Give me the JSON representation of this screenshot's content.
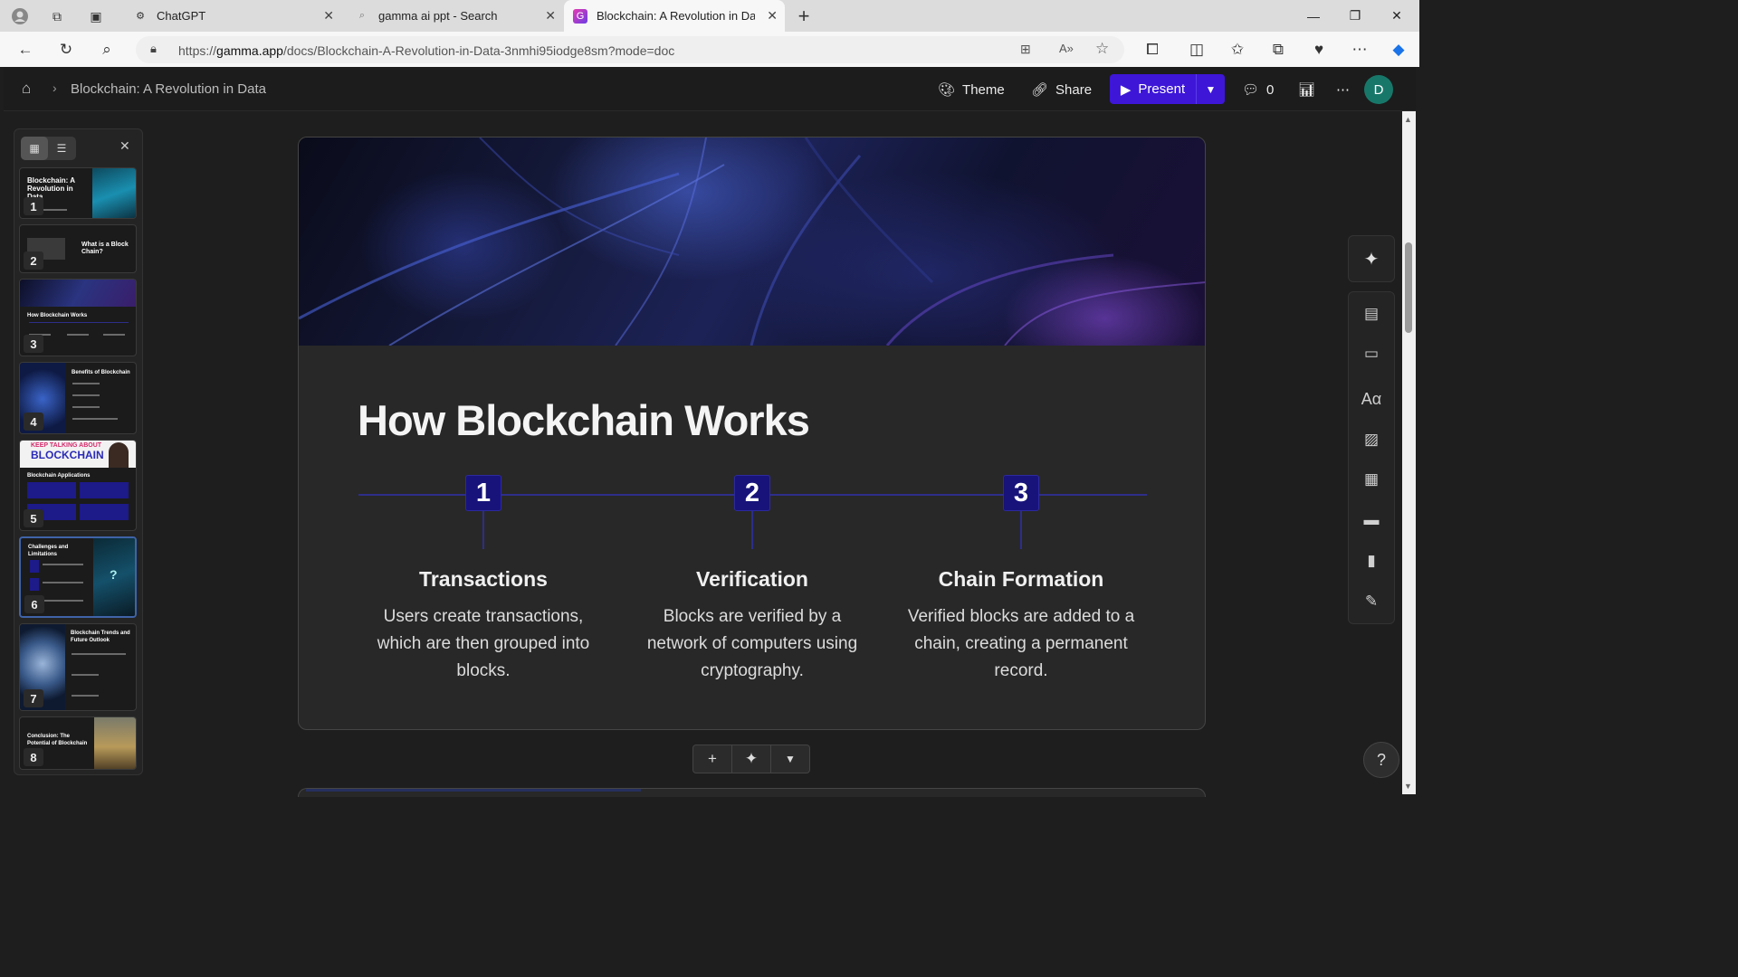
{
  "browser": {
    "tabs": [
      {
        "title": "ChatGPT",
        "icon": "chatgpt-icon"
      },
      {
        "title": "gamma ai ppt - Search",
        "icon": "search-icon"
      },
      {
        "title": "Blockchain: A Revolution in Data",
        "icon": "gamma-icon",
        "active": true
      }
    ],
    "url_prefix": "https://",
    "url_domain": "gamma.app",
    "url_path": "/docs/Blockchain-A-Revolution-in-Data-3nmhi95iodge8sm?mode=doc"
  },
  "app": {
    "breadcrumb": "Blockchain: A Revolution in Data",
    "theme_label": "Theme",
    "share_label": "Share",
    "present_label": "Present",
    "comments_count": "0",
    "avatar_initial": "D",
    "accent": "#3d16d8"
  },
  "slides": [
    {
      "num": "1",
      "title": "Blockchain: A Revolution in Data"
    },
    {
      "num": "2",
      "title": "What is a Block Chain?"
    },
    {
      "num": "3",
      "title": "How Blockchain Works"
    },
    {
      "num": "4",
      "title": "Benefits of Blockchain"
    },
    {
      "num": "5",
      "title": "Blockchain Applications",
      "banner_line1": "KEEP TALKING ABOUT",
      "banner_line2": "BLOCKCHAIN"
    },
    {
      "num": "6",
      "title": "Challenges and Limitations",
      "selected": true
    },
    {
      "num": "7",
      "title": "Blockchain Trends and Future Outlook"
    },
    {
      "num": "8",
      "title": "Conclusion: The Potential of Blockchain"
    }
  ],
  "card": {
    "title": "How Blockchain Works",
    "steps": [
      {
        "num": "1",
        "heading": "Transactions",
        "text": "Users create transactions, which are then grouped into blocks."
      },
      {
        "num": "2",
        "heading": "Verification",
        "text": "Blocks are verified by a network of computers using cryptography."
      },
      {
        "num": "3",
        "heading": "Chain Formation",
        "text": "Verified blocks are added to a chain, creating a permanent record."
      }
    ]
  },
  "help_label": "?"
}
